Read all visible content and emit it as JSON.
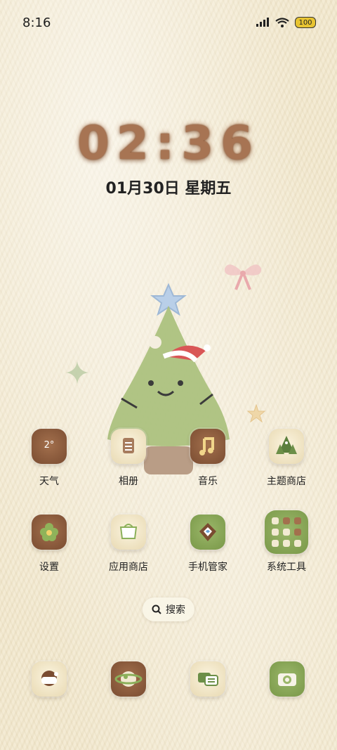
{
  "status_bar": {
    "time": "8:16",
    "battery": "100"
  },
  "lockclock": {
    "time": "02:36",
    "date": "01月30日 星期五"
  },
  "apps_row1": [
    {
      "label": "天气",
      "icon": "weather-icon",
      "badge": "2°"
    },
    {
      "label": "相册",
      "icon": "gallery-icon"
    },
    {
      "label": "音乐",
      "icon": "music-icon"
    },
    {
      "label": "主题商店",
      "icon": "theme-store-icon"
    }
  ],
  "apps_row2": [
    {
      "label": "设置",
      "icon": "settings-icon"
    },
    {
      "label": "应用商店",
      "icon": "app-store-icon"
    },
    {
      "label": "手机管家",
      "icon": "phone-manager-icon"
    },
    {
      "label": "系统工具",
      "icon": "system-tools-folder-icon"
    }
  ],
  "search": {
    "label": "搜索"
  },
  "dock": [
    {
      "icon": "phone-icon"
    },
    {
      "icon": "browser-icon"
    },
    {
      "icon": "messages-icon"
    },
    {
      "icon": "camera-icon"
    }
  ]
}
